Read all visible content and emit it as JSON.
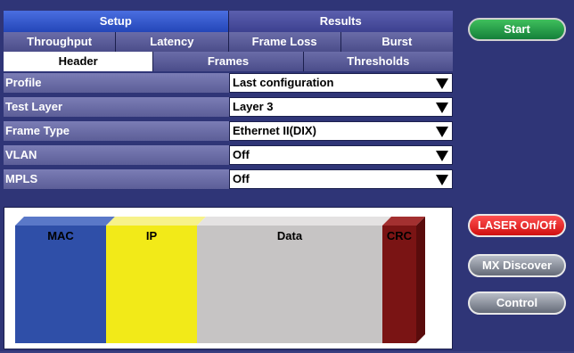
{
  "tabs_top": [
    "Setup",
    "Results"
  ],
  "tabs_sub": [
    "Throughput",
    "Latency",
    "Frame Loss",
    "Burst"
  ],
  "tabs_sub2": [
    "Header",
    "Frames",
    "Thresholds"
  ],
  "settings": [
    {
      "label": "Profile",
      "value": "Last configuration"
    },
    {
      "label": "Test Layer",
      "value": "Layer 3"
    },
    {
      "label": "Frame Type",
      "value": "Ethernet II(DIX)"
    },
    {
      "label": "VLAN",
      "value": "Off"
    },
    {
      "label": "MPLS",
      "value": "Off"
    }
  ],
  "frame_diagram": {
    "segments": [
      {
        "label": "MAC",
        "color": "#2f4fa8"
      },
      {
        "label": "IP",
        "color": "#f2ea18"
      },
      {
        "label": "Data",
        "color": "#c6c4c4"
      },
      {
        "label": "CRC",
        "color": "#7a1414"
      }
    ]
  },
  "buttons": {
    "start": "Start",
    "laser": "LASER On/Off",
    "mx_discover": "MX Discover",
    "control": "Control"
  },
  "colors": {
    "active_tab": "#2446b8",
    "start_green": "#14803a",
    "laser_red": "#d01010"
  }
}
